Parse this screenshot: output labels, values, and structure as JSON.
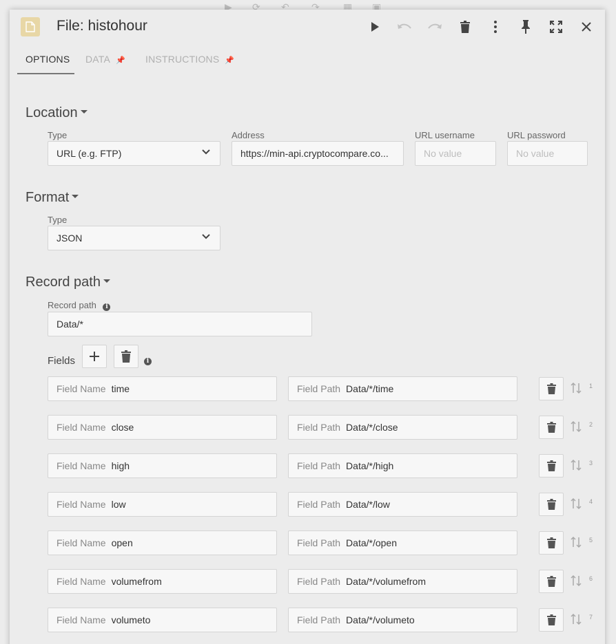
{
  "dialog": {
    "title": "File: histohour"
  },
  "tabs": [
    {
      "label": "OPTIONS"
    },
    {
      "label": "DATA"
    },
    {
      "label": "INSTRUCTIONS"
    }
  ],
  "location": {
    "section_title": "Location",
    "type_label": "Type",
    "type_value": "URL (e.g. FTP)",
    "address_label": "Address",
    "address_value": "https://min-api.cryptocompare.co...",
    "username_label": "URL username",
    "username_placeholder": "No value",
    "password_label": "URL password",
    "password_placeholder": "No value"
  },
  "format": {
    "section_title": "Format",
    "type_label": "Type",
    "type_value": "JSON"
  },
  "record_path": {
    "section_title": "Record path",
    "label": "Record path",
    "value": "Data/*"
  },
  "fields": {
    "label": "Fields",
    "name_prefix": "Field Name",
    "path_prefix": "Field Path",
    "rows": [
      {
        "name": "time",
        "path": "Data/*/time",
        "index": "1"
      },
      {
        "name": "close",
        "path": "Data/*/close",
        "index": "2"
      },
      {
        "name": "high",
        "path": "Data/*/high",
        "index": "3"
      },
      {
        "name": "low",
        "path": "Data/*/low",
        "index": "4"
      },
      {
        "name": "open",
        "path": "Data/*/open",
        "index": "5"
      },
      {
        "name": "volumefrom",
        "path": "Data/*/volumefrom",
        "index": "6"
      },
      {
        "name": "volumeto",
        "path": "Data/*/volumeto",
        "index": "7"
      }
    ]
  },
  "icons": {
    "header": [
      "file-icon",
      "play-icon",
      "undo-icon",
      "redo-icon",
      "delete-icon",
      "more-vert-icon",
      "pin-icon",
      "fullscreen-icon",
      "close-icon"
    ],
    "disabled_color": "#c4c4c4",
    "accent_file_icon": "#e8d7a6"
  }
}
